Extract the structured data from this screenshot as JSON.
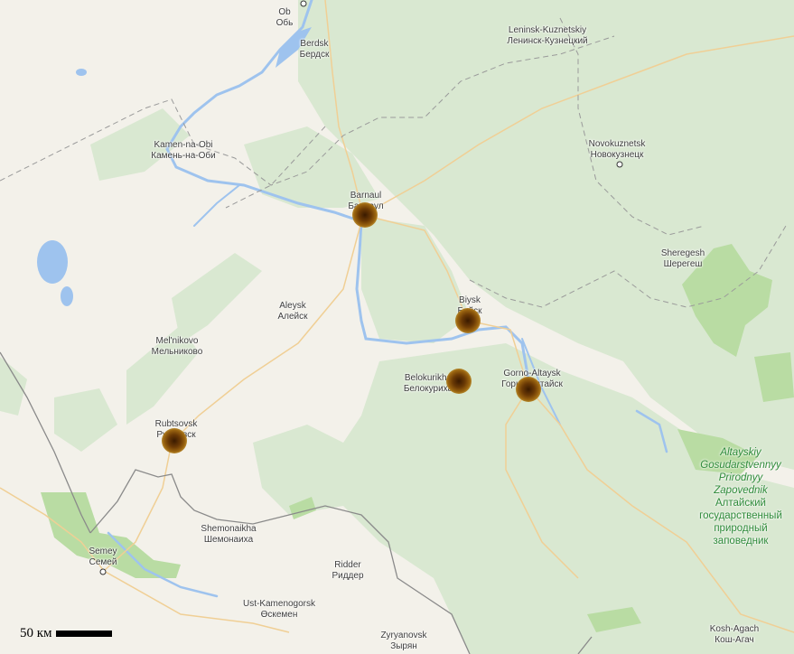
{
  "map": {
    "colors": {
      "land": "#f3f1ea",
      "forest": "#d6e6cf",
      "park": "#b7dca0",
      "water": "#a6c8f0",
      "road": "#f1cf8f",
      "border": "#888888",
      "marker": "#6b3a05"
    },
    "cities": [
      {
        "lat": "Ob",
        "cyr": "Обь"
      },
      {
        "lat": "Berdsk",
        "cyr": "Бердск"
      },
      {
        "lat": "Leninsk-Kuznetskiy",
        "cyr": "Ленинск-Кузнецкий"
      },
      {
        "lat": "Novokuznetsk",
        "cyr": "Новокузнецк"
      },
      {
        "lat": "Kamen-na-Obi",
        "cyr": "Камень-на-Оби"
      },
      {
        "lat": "Barnaul",
        "cyr": "Барнаул"
      },
      {
        "lat": "Biysk",
        "cyr": "Бийск"
      },
      {
        "lat": "Sheregesh",
        "cyr": "Шерегеш"
      },
      {
        "lat": "Aleysk",
        "cyr": "Алейск"
      },
      {
        "lat": "Mel'nikovo",
        "cyr": "Мельниково"
      },
      {
        "lat": "Belokurikha",
        "cyr": "Белокуриха"
      },
      {
        "lat": "Gorno-Altaysk",
        "cyr": "Горно-Алтайск"
      },
      {
        "lat": "Rubtsovsk",
        "cyr": "Рубцовск"
      },
      {
        "lat": "Shemonaikha",
        "cyr": "Шемонаиха"
      },
      {
        "lat": "Ridder",
        "cyr": "Риддер"
      },
      {
        "lat": "Semey",
        "cyr": "Семей"
      },
      {
        "lat": "Ust-Kamenogorsk",
        "cyr": "Өскемен"
      },
      {
        "lat": "Zyryanovsk",
        "cyr": "Зырян"
      },
      {
        "lat": "Kosh-Agach",
        "cyr": "Кош-Агач"
      }
    ],
    "park": {
      "lat1": "Altayskiy",
      "lat2": "Gosudarstvennyy",
      "lat3": "Prirodnyy",
      "lat4": "Zapovednik",
      "cyr1": "Алтайский",
      "cyr2": "государственный",
      "cyr3": "природный",
      "cyr4": "заповедник"
    },
    "markers": [
      "Barnaul",
      "Biysk",
      "Belokurikha",
      "Gorno-Altaysk",
      "Rubtsovsk"
    ],
    "scale": {
      "label": "50 км"
    }
  }
}
